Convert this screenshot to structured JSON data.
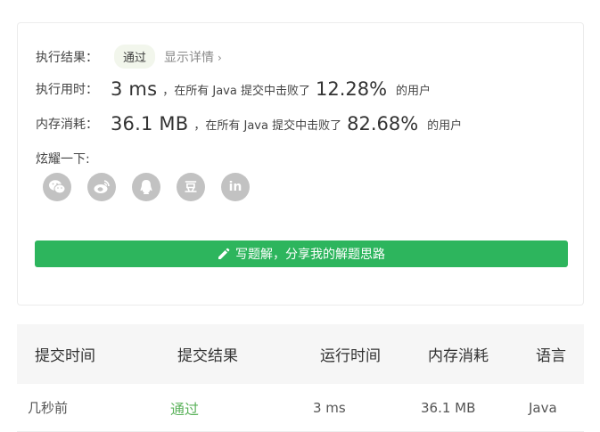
{
  "result": {
    "label": "执行结果：",
    "status": "通过",
    "detail_link": "显示详情",
    "detail_chevron": "›"
  },
  "runtime": {
    "label": "执行用时：",
    "value": "3 ms",
    "mid_text": "，在所有 Java 提交中击败了",
    "percent": "12.28%",
    "suffix": "的用户"
  },
  "memory": {
    "label": "内存消耗：",
    "value": "36.1 MB",
    "mid_text": "，在所有 Java 提交中击败了",
    "percent": "82.68%",
    "suffix": "的用户"
  },
  "share": {
    "label": "炫耀一下:",
    "icons": [
      "wechat-icon",
      "weibo-icon",
      "qq-icon",
      "douban-icon",
      "linkedin-icon"
    ],
    "douban_glyph": "豆",
    "linkedin_glyph": "in"
  },
  "write_button": {
    "label": "写题解，分享我的解题思路"
  },
  "table": {
    "headers": [
      "提交时间",
      "提交结果",
      "运行时间",
      "内存消耗",
      "语言"
    ],
    "rows": [
      {
        "time": "几秒前",
        "result": "通过",
        "runtime": "3 ms",
        "memory": "36.1 MB",
        "language": "Java"
      }
    ]
  },
  "colors": {
    "accent_green": "#2db55d",
    "result_green": "#5bb25b",
    "share_gray": "#c2c2c2"
  }
}
